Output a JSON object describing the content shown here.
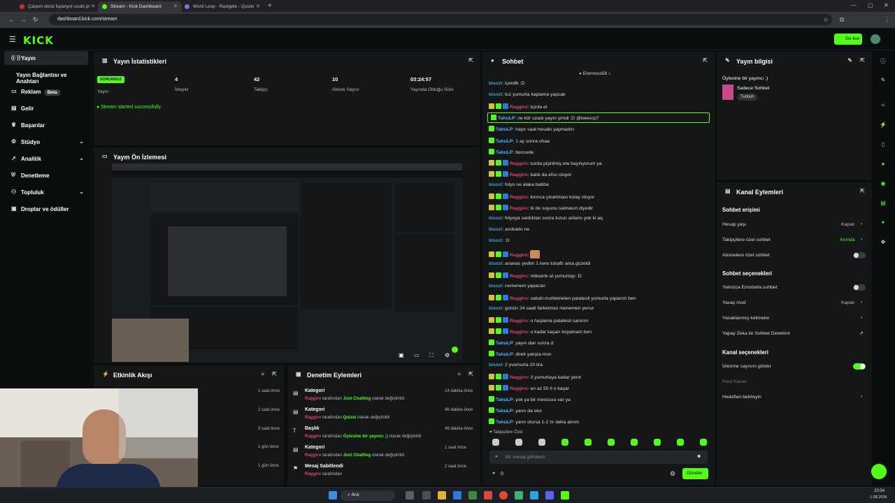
{
  "browser": {
    "tabs": [
      {
        "title": "Çarpım dizisi İspanyol usulü pr",
        "active": false
      },
      {
        "title": "Stream - Kick Dashboard",
        "active": true
      },
      {
        "title": "Word Loop - Rastgele - Quizei",
        "active": false
      }
    ],
    "url": "dashboard.kick.com/stream"
  },
  "header": {
    "logo": "KICK",
    "go_live": "Go live"
  },
  "sidebar": {
    "items": [
      {
        "label": "Yayın",
        "active": true,
        "icon": "broadcast-icon"
      },
      {
        "label": "Yayın Bağlantısı ve Anahtarı"
      },
      {
        "label": "Reklam",
        "badge": "Beta",
        "icon": "megaphone-icon"
      },
      {
        "label": "Gelir",
        "icon": "money-icon"
      },
      {
        "label": "Başarılar",
        "icon": "trophy-icon"
      },
      {
        "label": "Stüdyo",
        "icon": "studio-icon",
        "expandable": true
      },
      {
        "label": "Analitik",
        "icon": "chart-icon",
        "expandable": true
      },
      {
        "label": "Denetleme",
        "icon": "shield-icon"
      },
      {
        "label": "Topluluk",
        "icon": "community-icon",
        "expandable": true
      },
      {
        "label": "Droplar ve ödüller",
        "icon": "gift-icon"
      }
    ]
  },
  "stats": {
    "title": "Yayın İstatistikleri",
    "status_badge": "SORUNSUZ",
    "status_label": "Yayın",
    "viewers": "4",
    "viewers_label": "İzleyici",
    "followers": "42",
    "followers_label": "Takipçi",
    "subs": "10",
    "subs_label": "Abone Sayısı",
    "uptime": "03:24:57",
    "uptime_label": "Yayında Olduğu Süre",
    "success_msg": "Stream started successfully."
  },
  "preview": {
    "title": "Yayın Ön İzlemesi"
  },
  "activity": {
    "title": "Etkinlik Akışı",
    "items": [
      {
        "time": "1 saat önce"
      },
      {
        "time": "2 saat önce"
      },
      {
        "time": "3 saat önce"
      },
      {
        "time": "1 gün önce"
      },
      {
        "time": "1 gün önce"
      }
    ]
  },
  "moderation": {
    "title": "Denetim Eylemleri",
    "items": [
      {
        "title": "Kategori",
        "user": "Raggiro",
        "mid": " tarafından ",
        "value": "Just Chatting",
        "tail": " olarak değiştirildi",
        "time": "14 dakika önce"
      },
      {
        "title": "Kategori",
        "user": "Raggiro",
        "mid": " tarafından ",
        "value": "Quizei",
        "tail": " olarak değiştirildi",
        "time": "46 dakika önce"
      },
      {
        "title": "Başlık",
        "user": "Raggiro",
        "mid": " tarafından ",
        "value": "Öylesine bir yayıncı ;)",
        "tail": " olarak değiştirildi",
        "time": "46 dakika önce"
      },
      {
        "title": "Kategori",
        "user": "Raggiro",
        "mid": " tarafından ",
        "value": "Just Chatting",
        "tail": " olarak değiştirildi",
        "time": "1 saat önce"
      },
      {
        "title": "Mesaj Sabitlendi",
        "user": "Raggiro",
        "mid": " tarafından",
        "value": "",
        "tail": "",
        "time": "2 saat önce"
      }
    ]
  },
  "chat": {
    "title": "Sohbet",
    "pinned_user": "Erennsss58",
    "pinned_count": "1",
    "messages": [
      {
        "user": "bisozi",
        "text": "içerdik :D",
        "type": "b"
      },
      {
        "user": "bisozi",
        "text": "tuz yumurta kaplama yapcak",
        "type": "b"
      },
      {
        "user": "Raggiro",
        "text": "tuzda et",
        "type": "r"
      },
      {
        "user": "TahuLP",
        "text": "ne kdr uzadı yayın şimdi :D @beescp7",
        "type": "t",
        "highlight": true
      },
      {
        "user": "TahuLP",
        "text": "hayır saat hesabı yapmadın",
        "type": "t"
      },
      {
        "user": "TahuLP",
        "text": "1 ay sonra ohaa",
        "type": "t"
      },
      {
        "user": "TahuLP",
        "text": "bencede",
        "type": "t"
      },
      {
        "user": "Raggiro",
        "text": "tuzda pişirilmiş ete bayılıyorum ya",
        "type": "r"
      },
      {
        "user": "Raggiro",
        "text": "balık da efso oluyor",
        "type": "r"
      },
      {
        "user": "bisozi",
        "text": "folyo ne alaka babba",
        "type": "b"
      },
      {
        "user": "Raggiro",
        "text": "kırınca çıkartması kolay oluyor",
        "type": "r"
      },
      {
        "user": "Raggiro",
        "text": "bi de suyunu salmasın diyedir",
        "type": "r"
      },
      {
        "user": "bisozi",
        "text": "folyoya sardıktan sonra tuzun anlamı yok ki aq",
        "type": "b"
      },
      {
        "user": "bisozi",
        "text": "avokado ne",
        "type": "b"
      },
      {
        "user": "bisozi",
        "text": ":D",
        "type": "b"
      },
      {
        "user": "Raggiro",
        "text": "",
        "type": "r",
        "emote": true
      },
      {
        "user": "bisozi",
        "text": "ananas yedim 1 kere tuhaftı ama güzeldi",
        "type": "b"
      },
      {
        "user": "Raggiro",
        "text": "mikserle at yumurtayı :D",
        "type": "r"
      },
      {
        "user": "bisozi",
        "text": "nemenem yapacan",
        "type": "b"
      },
      {
        "user": "Raggiro",
        "text": "sabah muhtemelen patatesli yumurta yaparım ben",
        "type": "r"
      },
      {
        "user": "bisozi",
        "text": "günün 24 saati farketmez menemen yenur",
        "type": "b"
      },
      {
        "user": "Raggiro",
        "text": "o haşlama patatesli sanırım",
        "type": "r"
      },
      {
        "user": "Raggiro",
        "text": "o kadar kaşarı koyamam ben",
        "type": "r"
      },
      {
        "user": "TahuLP",
        "text": "yayın dan sonra d",
        "type": "t"
      },
      {
        "user": "TahuLP",
        "text": "direk yatışta msn",
        "type": "t"
      },
      {
        "user": "bisozi",
        "text": "2 yvumurta 20 lira",
        "type": "b"
      },
      {
        "user": "Raggiro",
        "text": "3 yumurtaya kadar yenir",
        "type": "r"
      },
      {
        "user": "Raggiro",
        "text": "en az 50 tl o kaşar",
        "type": "r"
      },
      {
        "user": "TahuLP",
        "text": "yok ya bir mevzusu var ya",
        "type": "t"
      },
      {
        "user": "TahuLP",
        "text": "yarın da olur",
        "type": "t"
      },
      {
        "user": "TahuLP",
        "text": "yarın olursa 1-2 tır daha alınm",
        "type": "t"
      }
    ],
    "followers_only": "Takipçilere Özel",
    "input_placeholder": "Bir mesaj gönderin",
    "send": "Gönder",
    "count": "0"
  },
  "stream_info": {
    "title": "Yayın bilgisi",
    "stream_title": "Öylesine bir yayıncı ;)",
    "category": "Sadece Sohbet",
    "tag": "Turkish"
  },
  "channel_actions": {
    "title": "Kanal Eylemleri",
    "chat_access": "Sohbet erişimi",
    "account_age": "Hesap yaşı",
    "account_age_value": "Kapalı",
    "followers_chat": "Takipçilere özel sohbet",
    "followers_chat_value": "Anında",
    "subs_chat": "Abonelere özel sohbet",
    "chat_options": "Sohbet seçenekleri",
    "emotes_only": "Yalnızca Emotlarla sohbet",
    "slow_mode": "Yavaş mod",
    "slow_mode_value": "Kapalı",
    "banned_words": "Yasaklanmış kelimeler",
    "ai_mod": "Yapay Zeka ile Sohbet Denetimi",
    "channel_options": "Kanal seçenekleri",
    "show_viewers": "İzlenme sayısını göster",
    "raid_channel": "Raid Kanalı",
    "set_goals": "Hedefleri belirleyin"
  },
  "taskbar": {
    "search": "Ara",
    "time": "23:54",
    "date": "1.08.2026"
  }
}
